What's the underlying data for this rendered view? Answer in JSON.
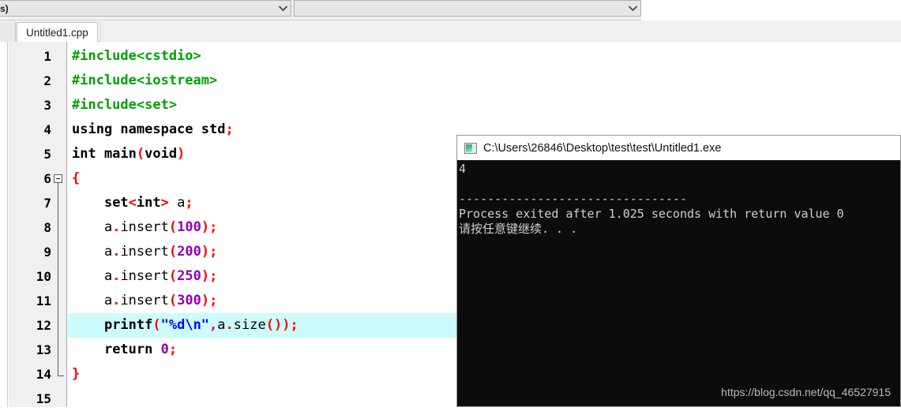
{
  "toolbar": {
    "combo_class_value": "s)",
    "combo_member_value": "",
    "combo_class_name": "class-browser-combo",
    "combo_member_name": "member-browser-combo"
  },
  "tabs": {
    "active_label": "Untitled1.cpp"
  },
  "editor": {
    "highlighted_line": 12,
    "fold_start_line": 6,
    "fold_end_line": 14,
    "lines": [
      {
        "n": "1",
        "tokens": [
          {
            "t": "pre",
            "v": "#include<cstdio>"
          }
        ]
      },
      {
        "n": "2",
        "tokens": [
          {
            "t": "pre",
            "v": "#include<iostream>"
          }
        ]
      },
      {
        "n": "3",
        "tokens": [
          {
            "t": "pre",
            "v": "#include<set>"
          }
        ]
      },
      {
        "n": "4",
        "tokens": [
          {
            "t": "kw",
            "v": "using namespace std"
          },
          {
            "t": "punc",
            "v": ";"
          }
        ]
      },
      {
        "n": "5",
        "tokens": [
          {
            "t": "kw",
            "v": "int main"
          },
          {
            "t": "punc",
            "v": "("
          },
          {
            "t": "kw",
            "v": "void"
          },
          {
            "t": "punc",
            "v": ")"
          }
        ]
      },
      {
        "n": "6",
        "tokens": [
          {
            "t": "punc",
            "v": "{"
          }
        ]
      },
      {
        "n": "7",
        "tokens": [
          {
            "t": "id",
            "v": "    "
          },
          {
            "t": "kw",
            "v": "set"
          },
          {
            "t": "punc",
            "v": "<"
          },
          {
            "t": "kw",
            "v": "int"
          },
          {
            "t": "punc",
            "v": "> "
          },
          {
            "t": "id",
            "v": "a"
          },
          {
            "t": "punc",
            "v": ";"
          }
        ]
      },
      {
        "n": "8",
        "tokens": [
          {
            "t": "id",
            "v": "    a"
          },
          {
            "t": "punc",
            "v": "."
          },
          {
            "t": "id",
            "v": "insert"
          },
          {
            "t": "punc",
            "v": "("
          },
          {
            "t": "num",
            "v": "100"
          },
          {
            "t": "punc",
            "v": ");"
          }
        ]
      },
      {
        "n": "9",
        "tokens": [
          {
            "t": "id",
            "v": "    a"
          },
          {
            "t": "punc",
            "v": "."
          },
          {
            "t": "id",
            "v": "insert"
          },
          {
            "t": "punc",
            "v": "("
          },
          {
            "t": "num",
            "v": "200"
          },
          {
            "t": "punc",
            "v": ");"
          }
        ]
      },
      {
        "n": "10",
        "tokens": [
          {
            "t": "id",
            "v": "    a"
          },
          {
            "t": "punc",
            "v": "."
          },
          {
            "t": "id",
            "v": "insert"
          },
          {
            "t": "punc",
            "v": "("
          },
          {
            "t": "num",
            "v": "250"
          },
          {
            "t": "punc",
            "v": ");"
          }
        ]
      },
      {
        "n": "11",
        "tokens": [
          {
            "t": "id",
            "v": "    a"
          },
          {
            "t": "punc",
            "v": "."
          },
          {
            "t": "id",
            "v": "insert"
          },
          {
            "t": "punc",
            "v": "("
          },
          {
            "t": "num",
            "v": "300"
          },
          {
            "t": "punc",
            "v": ");"
          }
        ]
      },
      {
        "n": "12",
        "tokens": [
          {
            "t": "id",
            "v": "    "
          },
          {
            "t": "kw",
            "v": "printf"
          },
          {
            "t": "punc",
            "v": "("
          },
          {
            "t": "str",
            "v": "\"%d\\n\""
          },
          {
            "t": "punc",
            "v": ","
          },
          {
            "t": "id",
            "v": "a"
          },
          {
            "t": "punc",
            "v": "."
          },
          {
            "t": "id",
            "v": "size"
          },
          {
            "t": "punc",
            "v": "());"
          }
        ]
      },
      {
        "n": "13",
        "tokens": [
          {
            "t": "id",
            "v": "    "
          },
          {
            "t": "kw",
            "v": "return "
          },
          {
            "t": "num",
            "v": "0"
          },
          {
            "t": "punc",
            "v": ";"
          }
        ]
      },
      {
        "n": "14",
        "tokens": [
          {
            "t": "punc",
            "v": "}"
          }
        ]
      },
      {
        "n": "15",
        "tokens": []
      }
    ]
  },
  "console": {
    "title": "C:\\Users\\26846\\Desktop\\test\\test\\Untitled1.exe",
    "icon": "console-window-icon",
    "output_lines": [
      "4",
      "",
      "--------------------------------",
      "Process exited after 1.025 seconds with return value 0",
      "请按任意键继续. . ."
    ],
    "watermark": "https://blog.csdn.net/qq_46527915"
  },
  "colors": {
    "preprocessor": "#00a000",
    "keyword": "#000000",
    "punctuation": "#ff0000",
    "number": "#9400b0",
    "string": "#0000ff",
    "current_line_highlight": "#ccfbfb",
    "console_bg": "#0c0c0c",
    "console_fg": "#cfcfcf"
  }
}
